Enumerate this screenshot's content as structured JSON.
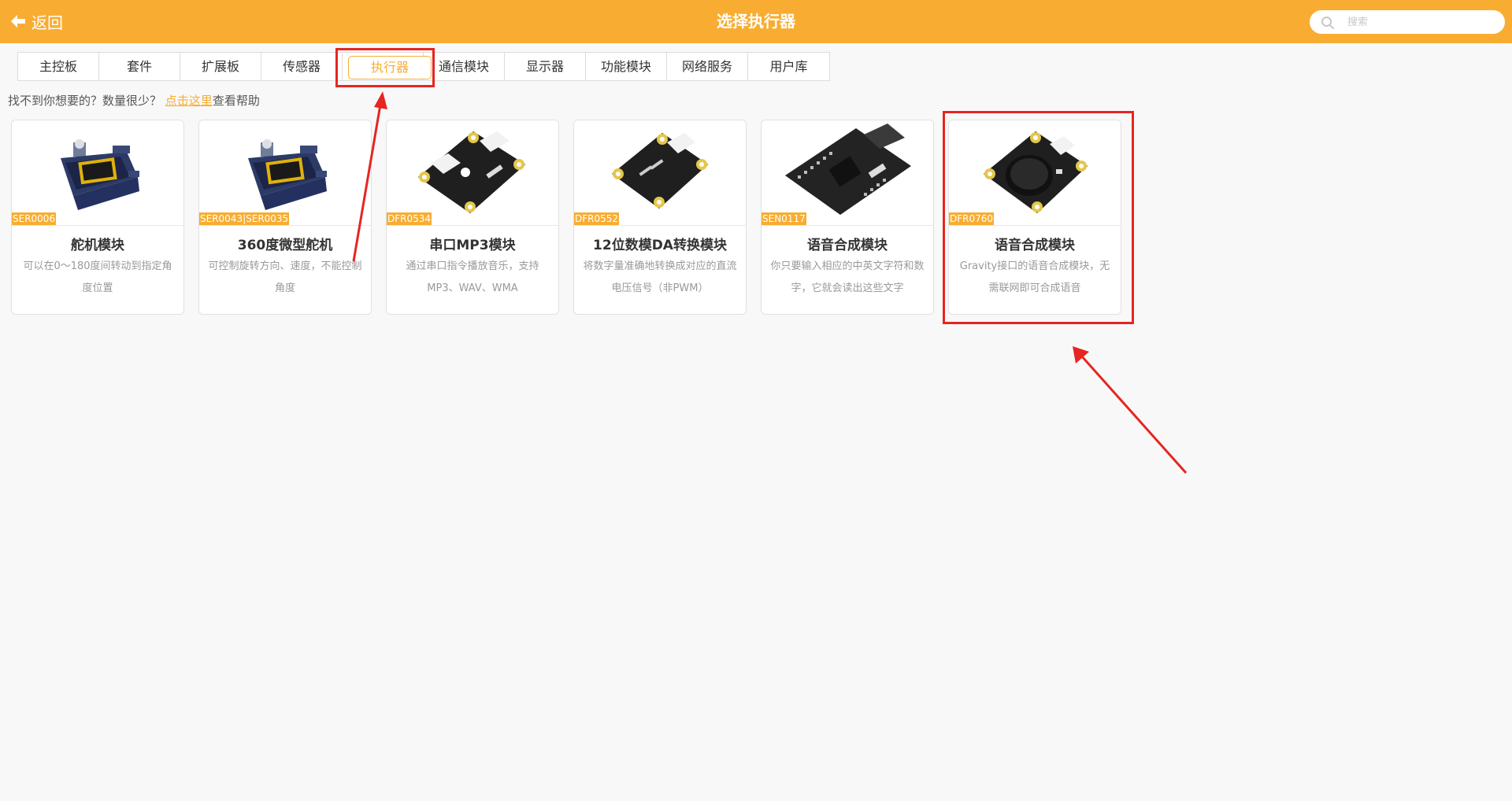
{
  "header": {
    "back_label": "返回",
    "title": "选择执行器",
    "search_placeholder": "搜索"
  },
  "tabs": [
    {
      "label": "主控板"
    },
    {
      "label": "套件"
    },
    {
      "label": "扩展板"
    },
    {
      "label": "传感器"
    },
    {
      "label": "执行器",
      "active": true
    },
    {
      "label": "通信模块"
    },
    {
      "label": "显示器"
    },
    {
      "label": "功能模块"
    },
    {
      "label": "网络服务"
    },
    {
      "label": "用户库"
    }
  ],
  "help": {
    "prefix": "找不到你想要的？数量很少？",
    "link": "点击这里",
    "suffix": "查看帮助"
  },
  "cards": [
    {
      "sku": "SER0006",
      "name": "舵机模块",
      "desc": "可以在0～180度间转动到指定角度位置",
      "image": "servo-image"
    },
    {
      "sku": "SER0043|SER0035",
      "name": "360度微型舵机",
      "desc": "可控制旋转方向、速度，不能控制角度",
      "image": "servo-image"
    },
    {
      "sku": "DFR0534",
      "name": "串口MP3模块",
      "desc": "通过串口指令播放音乐，支持MP3、WAV、WMA",
      "image": "mp3-board-image"
    },
    {
      "sku": "DFR0552",
      "name": "12位数模DA转换模块",
      "desc": "将数字量准确地转换成对应的直流电压信号（非PWM）",
      "image": "dac-board-image"
    },
    {
      "sku": "SEN0117",
      "name": "语音合成模块",
      "desc": "你只要输入相应的中英文字符和数字，它就会读出这些文字",
      "image": "speech-shield-image"
    },
    {
      "sku": "DFR0760",
      "name": "语音合成模块",
      "desc": "Gravity接口的语音合成模块，无需联网即可合成语音",
      "image": "speech-gravity-image"
    }
  ],
  "colors": {
    "accent": "#f8ad32",
    "annotation": "#e52621"
  }
}
